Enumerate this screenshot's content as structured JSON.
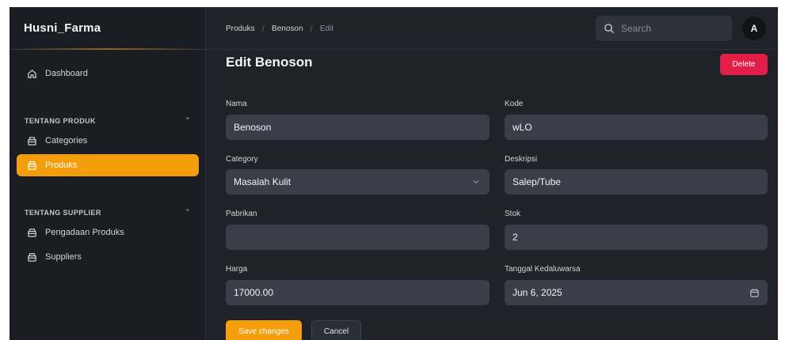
{
  "brand": {
    "name": "Husni_Farma"
  },
  "sidebar": {
    "dashboard_label": "Dashboard",
    "groups": [
      {
        "title": "TENTANG PRODUK",
        "items": [
          {
            "label": "Categories",
            "active": false
          },
          {
            "label": "Produks",
            "active": true
          }
        ]
      },
      {
        "title": "TENTANG SUPPLIER",
        "items": [
          {
            "label": "Pengadaan Produks",
            "active": false
          },
          {
            "label": "Suppliers",
            "active": false
          }
        ]
      }
    ]
  },
  "topbar": {
    "breadcrumb": [
      "Produks",
      "Benoson",
      "Edit"
    ],
    "search_placeholder": "Search",
    "avatar_initial": "A"
  },
  "page": {
    "title": "Edit Benoson",
    "delete_label": "Delete"
  },
  "form": {
    "nama": {
      "label": "Nama",
      "value": "Benoson"
    },
    "kode": {
      "label": "Kode",
      "value": "wLO"
    },
    "category": {
      "label": "Category",
      "value": "Masalah Kulit"
    },
    "deskripsi": {
      "label": "Deskripsi",
      "value": "Salep/Tube"
    },
    "pabrikan": {
      "label": "Pabrikan",
      "value": ""
    },
    "stok": {
      "label": "Stok",
      "value": "2"
    },
    "harga": {
      "label": "Harga",
      "value": "17000.00"
    },
    "tanggal": {
      "label": "Tanggal Kedaluwarsa",
      "value": "Jun 6, 2025"
    }
  },
  "actions": {
    "save_label": "Save changes",
    "cancel_label": "Cancel"
  },
  "colors": {
    "accent": "#f59e0b",
    "danger": "#e11d48",
    "surface": "#1f2229",
    "input": "#3a3e48"
  },
  "icons": {
    "dashboard": "home-icon",
    "menu": "box-icon",
    "search": "search-icon",
    "calendar": "calendar-icon",
    "select": "chevron-down-icon",
    "group": "chevron-up-icon"
  }
}
